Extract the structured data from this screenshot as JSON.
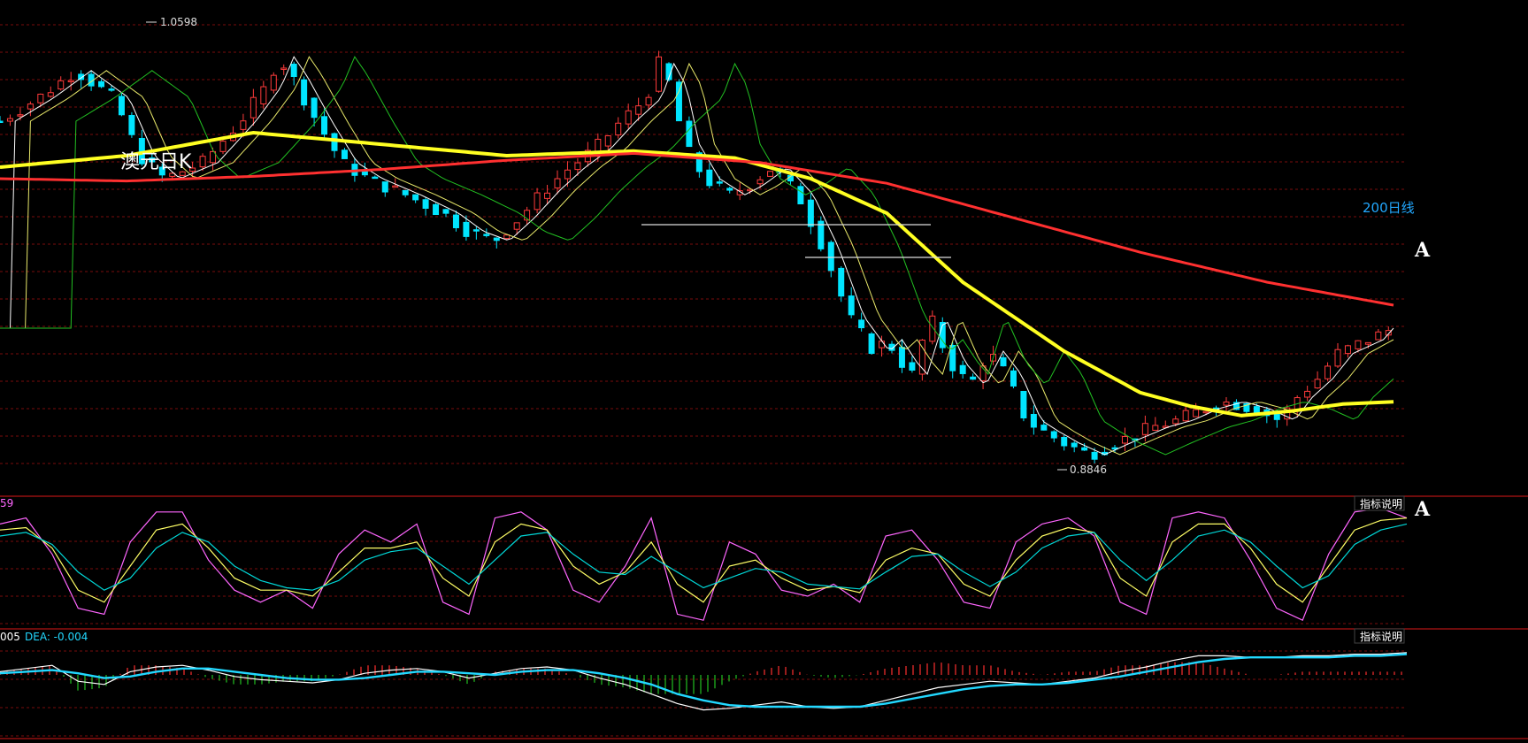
{
  "chart_data": [
    {
      "type": "candlestick",
      "title": "澳元日K",
      "high_label": "1.0598",
      "low_label": "0.8846",
      "annotations": {
        "ma200_label": "200日线",
        "marker_top": "A"
      },
      "colors": {
        "up": "#ff3b3b",
        "down": "#00e5ff",
        "ma200": "#ff3030",
        "ma_yellow": "#ffff22",
        "ma_green": "#22c022",
        "ma_thin": "#e8e86a",
        "ma_white": "#ffffff"
      },
      "price_points": [
        [
          0,
          1.03
        ],
        [
          15,
          1.04
        ],
        [
          30,
          1.052
        ],
        [
          45,
          1.04
        ],
        [
          55,
          1.015
        ],
        [
          65,
          1.005
        ],
        [
          80,
          1.012
        ],
        [
          95,
          1.03
        ],
        [
          105,
          1.045
        ],
        [
          110,
          1.058
        ],
        [
          115,
          1.05
        ],
        [
          125,
          1.03
        ],
        [
          135,
          1.012
        ],
        [
          145,
          1.005
        ],
        [
          160,
          0.998
        ],
        [
          175,
          0.99
        ],
        [
          185,
          0.982
        ],
        [
          195,
          0.978
        ],
        [
          205,
          0.988
        ],
        [
          215,
          1.0
        ],
        [
          225,
          1.01
        ],
        [
          235,
          1.018
        ],
        [
          245,
          1.03
        ],
        [
          255,
          1.04
        ],
        [
          260,
          1.055
        ],
        [
          265,
          1.045
        ],
        [
          270,
          1.02
        ],
        [
          278,
          1.005
        ],
        [
          288,
          0.998
        ],
        [
          295,
          1.002
        ],
        [
          305,
          1.01
        ],
        [
          315,
          0.998
        ],
        [
          325,
          0.975
        ],
        [
          335,
          0.945
        ],
        [
          345,
          0.93
        ],
        [
          350,
          0.935
        ],
        [
          356,
          0.925
        ],
        [
          360,
          0.92
        ],
        [
          367,
          0.945
        ],
        [
          375,
          0.925
        ],
        [
          383,
          0.915
        ],
        [
          390,
          0.93
        ],
        [
          397,
          0.92
        ],
        [
          405,
          0.9
        ],
        [
          412,
          0.895
        ],
        [
          420,
          0.89
        ],
        [
          430,
          0.885
        ],
        [
          440,
          0.89
        ],
        [
          455,
          0.897
        ],
        [
          465,
          0.9
        ],
        [
          475,
          0.905
        ],
        [
          485,
          0.908
        ],
        [
          495,
          0.905
        ],
        [
          505,
          0.9
        ],
        [
          512,
          0.91
        ],
        [
          520,
          0.918
        ],
        [
          528,
          0.929
        ],
        [
          540,
          0.935
        ],
        [
          550,
          0.94
        ]
      ],
      "ma_yellow_points": [
        [
          0,
          1.01
        ],
        [
          50,
          1.015
        ],
        [
          100,
          1.025
        ],
        [
          150,
          1.02
        ],
        [
          200,
          1.015
        ],
        [
          250,
          1.017
        ],
        [
          290,
          1.014
        ],
        [
          320,
          1.005
        ],
        [
          350,
          0.99
        ],
        [
          380,
          0.96
        ],
        [
          420,
          0.93
        ],
        [
          450,
          0.912
        ],
        [
          470,
          0.906
        ],
        [
          490,
          0.902
        ],
        [
          510,
          0.904
        ],
        [
          530,
          0.907
        ],
        [
          550,
          0.908
        ]
      ],
      "ma200_points": [
        [
          0,
          1.005
        ],
        [
          50,
          1.004
        ],
        [
          100,
          1.006
        ],
        [
          150,
          1.009
        ],
        [
          200,
          1.013
        ],
        [
          250,
          1.016
        ],
        [
          300,
          1.012
        ],
        [
          350,
          1.003
        ],
        [
          400,
          0.988
        ],
        [
          450,
          0.973
        ],
        [
          500,
          0.96
        ],
        [
          550,
          0.95
        ]
      ],
      "ylim": [
        0.875,
        1.075
      ],
      "x_count": 551
    },
    {
      "type": "line",
      "panel": "KDJ",
      "legend_value": "59",
      "button_label": "指标说明",
      "marker": "A",
      "series": [
        {
          "color": "#ff66ff",
          "values": [
            85,
            90,
            60,
            15,
            10,
            70,
            95,
            95,
            55,
            30,
            20,
            30,
            15,
            60,
            80,
            70,
            85,
            20,
            10,
            90,
            95,
            80,
            30,
            20,
            50,
            90,
            10,
            5,
            70,
            60,
            30,
            25,
            35,
            20,
            75,
            80,
            55,
            20,
            15,
            70,
            85,
            90,
            75,
            20,
            10,
            90,
            95,
            90,
            55,
            15,
            5,
            60,
            95,
            98,
            90
          ]
        },
        {
          "color": "#ffff66",
          "values": [
            80,
            82,
            65,
            30,
            20,
            50,
            80,
            85,
            65,
            40,
            30,
            30,
            25,
            45,
            65,
            65,
            70,
            40,
            25,
            70,
            85,
            80,
            50,
            35,
            45,
            70,
            35,
            20,
            50,
            55,
            40,
            30,
            33,
            28,
            55,
            65,
            60,
            35,
            25,
            55,
            75,
            82,
            78,
            40,
            25,
            70,
            85,
            85,
            65,
            35,
            20,
            50,
            80,
            88,
            90
          ]
        },
        {
          "color": "#00d8d8",
          "values": [
            75,
            78,
            68,
            45,
            30,
            40,
            65,
            78,
            70,
            50,
            38,
            32,
            30,
            38,
            55,
            62,
            65,
            50,
            35,
            55,
            75,
            78,
            60,
            45,
            43,
            58,
            45,
            32,
            40,
            48,
            45,
            35,
            33,
            31,
            45,
            58,
            60,
            45,
            33,
            45,
            65,
            75,
            78,
            55,
            38,
            55,
            75,
            80,
            70,
            50,
            32,
            42,
            68,
            80,
            85
          ]
        }
      ]
    },
    {
      "type": "bar",
      "panel": "MACD",
      "dif_label": "005",
      "dea_label": "DEA: -0.004",
      "button_label": "指标说明",
      "colors": {
        "pos": "#ff3030",
        "neg": "#22c022",
        "dif": "#ffffff",
        "dea": "#22d8ff"
      },
      "dif": [
        0.002,
        0.004,
        0.006,
        -0.004,
        -0.006,
        0.002,
        0.005,
        0.006,
        0.003,
        -0.001,
        -0.003,
        -0.004,
        -0.005,
        -0.003,
        0.001,
        0.003,
        0.004,
        0.002,
        -0.002,
        0.001,
        0.004,
        0.005,
        0.003,
        -0.002,
        -0.006,
        -0.012,
        -0.018,
        -0.022,
        -0.021,
        -0.019,
        -0.017,
        -0.02,
        -0.021,
        -0.02,
        -0.016,
        -0.012,
        -0.008,
        -0.006,
        -0.004,
        -0.005,
        -0.006,
        -0.004,
        -0.002,
        0.002,
        0.005,
        0.009,
        0.012,
        0.012,
        0.011,
        0.011,
        0.012,
        0.012,
        0.013,
        0.013,
        0.014
      ],
      "dea": [
        0.001,
        0.002,
        0.003,
        0.001,
        -0.002,
        -0.001,
        0.002,
        0.004,
        0.004,
        0.002,
        0.0,
        -0.002,
        -0.003,
        -0.003,
        -0.002,
        0.0,
        0.002,
        0.002,
        0.001,
        0.0,
        0.002,
        0.003,
        0.003,
        0.001,
        -0.002,
        -0.006,
        -0.012,
        -0.016,
        -0.019,
        -0.02,
        -0.02,
        -0.02,
        -0.02,
        -0.02,
        -0.018,
        -0.015,
        -0.012,
        -0.009,
        -0.007,
        -0.006,
        -0.006,
        -0.005,
        -0.003,
        -0.001,
        0.002,
        0.005,
        0.008,
        0.01,
        0.011,
        0.011,
        0.011,
        0.011,
        0.012,
        0.012,
        0.013
      ]
    }
  ]
}
